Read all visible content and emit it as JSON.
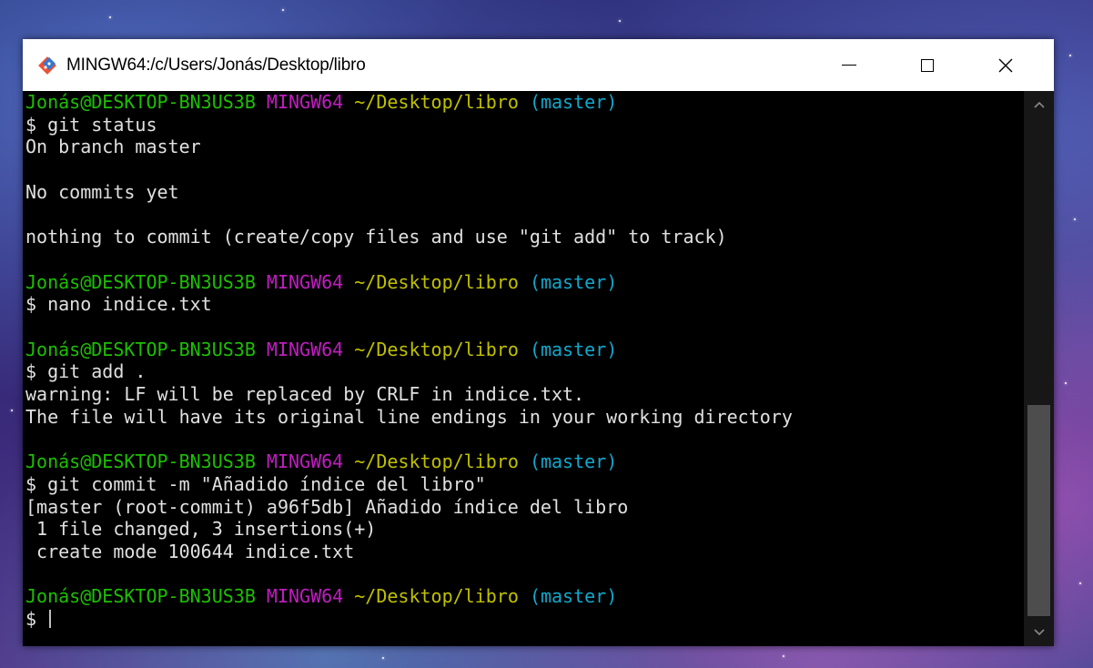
{
  "window": {
    "title": "MINGW64:/c/Users/Jonás/Desktop/libro"
  },
  "terminal": {
    "prompt": {
      "user": "Jonás@DESKTOP-BN3US3B",
      "env": "MINGW64",
      "path": "~/Desktop/libro",
      "branch": "(master)"
    },
    "lines": [
      {
        "type": "prompt"
      },
      {
        "type": "text",
        "text": "$ git status"
      },
      {
        "type": "text",
        "text": "On branch master"
      },
      {
        "type": "text",
        "text": ""
      },
      {
        "type": "text",
        "text": "No commits yet"
      },
      {
        "type": "text",
        "text": ""
      },
      {
        "type": "text",
        "text": "nothing to commit (create/copy files and use \"git add\" to track)"
      },
      {
        "type": "text",
        "text": ""
      },
      {
        "type": "prompt"
      },
      {
        "type": "text",
        "text": "$ nano indice.txt"
      },
      {
        "type": "text",
        "text": ""
      },
      {
        "type": "prompt"
      },
      {
        "type": "text",
        "text": "$ git add ."
      },
      {
        "type": "text",
        "text": "warning: LF will be replaced by CRLF in indice.txt."
      },
      {
        "type": "text",
        "text": "The file will have its original line endings in your working directory"
      },
      {
        "type": "text",
        "text": ""
      },
      {
        "type": "prompt"
      },
      {
        "type": "text",
        "text": "$ git commit -m \"Añadido índice del libro\""
      },
      {
        "type": "text",
        "text": "[master (root-commit) a96f5db] Añadido índice del libro"
      },
      {
        "type": "text",
        "text": " 1 file changed, 3 insertions(+)"
      },
      {
        "type": "text",
        "text": " create mode 100644 indice.txt"
      },
      {
        "type": "text",
        "text": ""
      },
      {
        "type": "prompt"
      },
      {
        "type": "input",
        "text": "$ "
      }
    ]
  },
  "icons": {
    "app": "git-bash-icon",
    "minimize": "minimize-icon",
    "maximize": "maximize-icon",
    "close": "close-icon",
    "scroll_up": "chevron-up-icon",
    "scroll_down": "chevron-down-icon"
  },
  "colors": {
    "background": "#000000",
    "text": "#c0c0c0",
    "user": "#1cc000",
    "env": "#c01dc0",
    "path": "#c0c000",
    "branch": "#11a8cd"
  }
}
